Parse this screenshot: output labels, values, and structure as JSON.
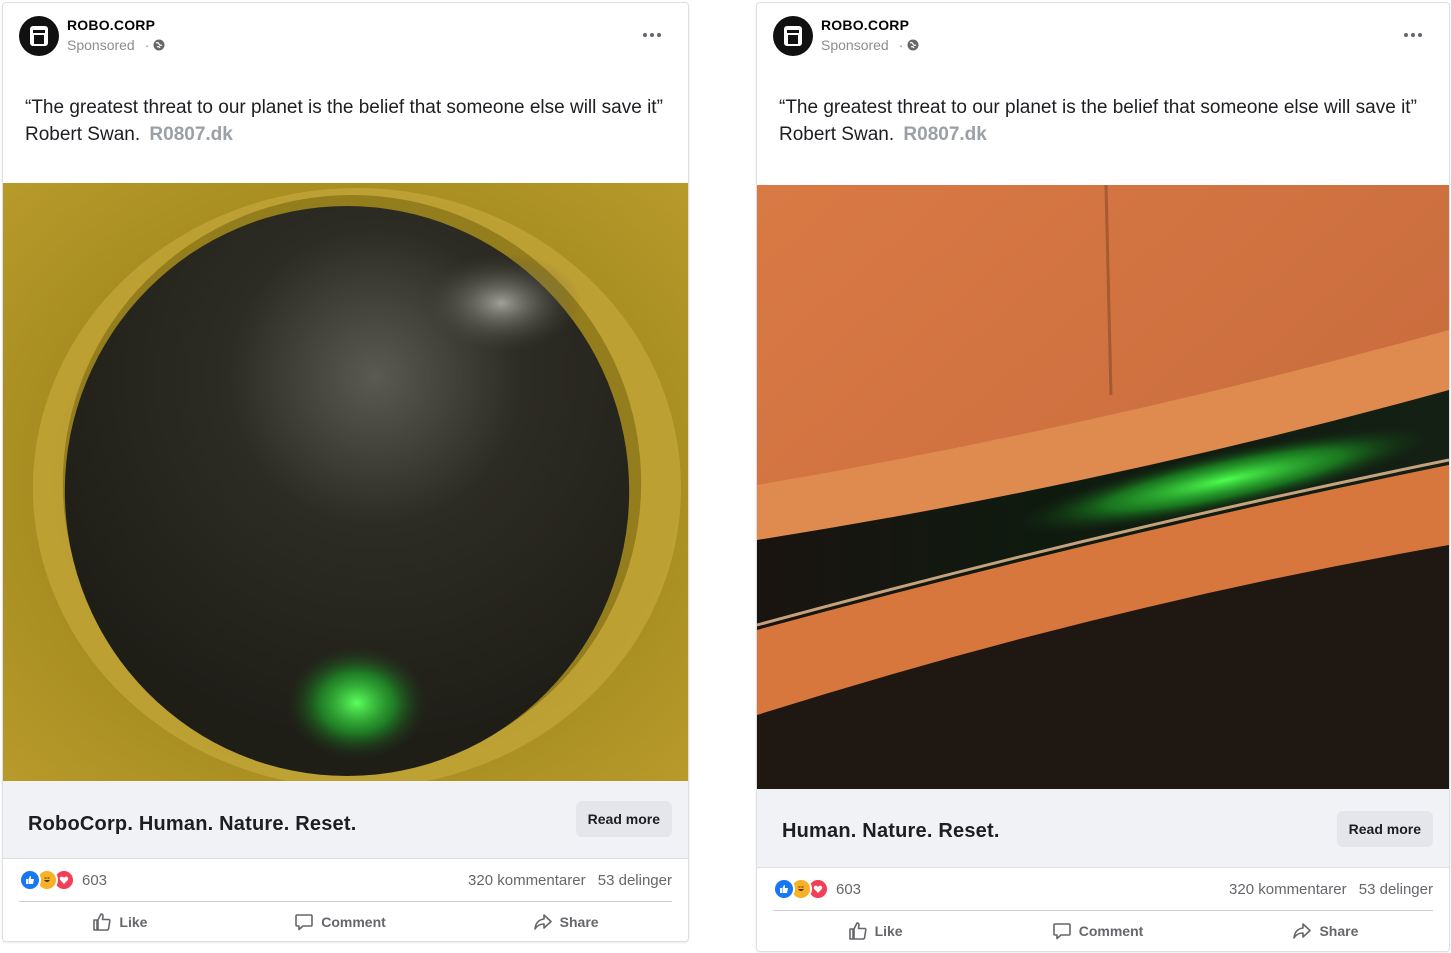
{
  "posts": [
    {
      "page_name": "ROBO.CORP",
      "sponsored": "Sponsored",
      "dot": "·",
      "caption_quote": "“The greatest threat to our planet is the belief that someone else will save it”",
      "caption_author": "Robert Swan.",
      "caption_link": "R0807.dk",
      "headline": "RoboCorp. Human. Nature. Reset.",
      "read_more": "Read more",
      "reaction_count": "603",
      "comments": "320 kommentarer",
      "shares": "53 delinger",
      "like_label": "Like",
      "comment_label": "Comment",
      "share_label": "Share"
    },
    {
      "page_name": "ROBO.CORP",
      "sponsored": "Sponsored",
      "dot": "·",
      "caption_quote": "“The greatest threat to our planet is the belief that someone else will save it”",
      "caption_author": "Robert Swan.",
      "caption_link": "R0807.dk",
      "headline": "Human. Nature. Reset.",
      "read_more": "Read more",
      "reaction_count": "603",
      "comments": "320 kommentarer",
      "shares": "53 delinger",
      "like_label": "Like",
      "comment_label": "Comment",
      "share_label": "Share"
    }
  ],
  "icons": {
    "avatar": "robot-logo-icon",
    "privacy": "globe-icon",
    "more": "more-horizontal-icon",
    "like": "thumbs-up-icon",
    "comment": "comment-bubble-icon",
    "share": "share-arrow-icon",
    "reactions": [
      "like-reaction-icon",
      "haha-reaction-icon",
      "love-reaction-icon"
    ]
  },
  "colors": {
    "link_bar": "#f0f2f5",
    "button": "#e4e6eb",
    "like_blue": "#1877f2",
    "love_red": "#f33e58",
    "haha_yellow": "#f7b125",
    "muted_text": "#65676b"
  }
}
